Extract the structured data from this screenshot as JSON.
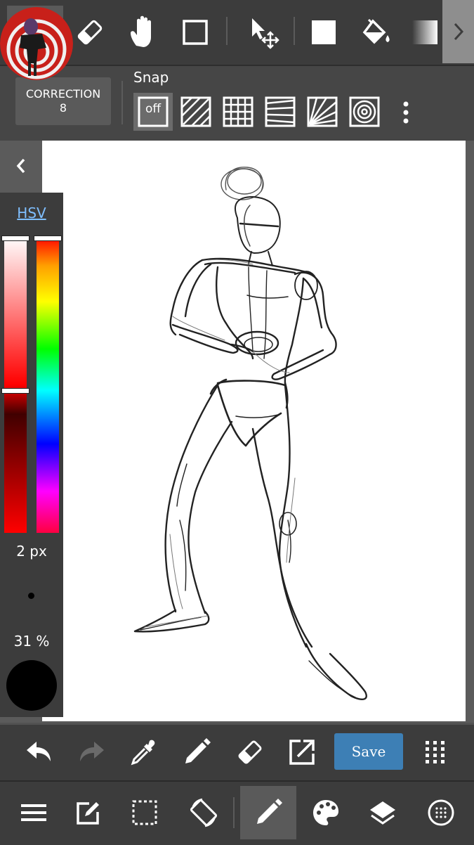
{
  "toolbar": {
    "tools": [
      "brush-icon",
      "eraser-icon",
      "hand-icon",
      "rectangle-select-icon",
      "move-icon",
      "fill-square-icon",
      "bucket-icon",
      "gradient-icon"
    ],
    "more_icon": "chevron-right-icon"
  },
  "snap_panel": {
    "correction_label": "CORRECTION",
    "correction_value": "8",
    "snap_label": "Snap",
    "off_label": "off",
    "selected": "off",
    "modes": [
      "off",
      "parallel",
      "grid",
      "vanishing",
      "radial",
      "concentric"
    ]
  },
  "color_panel": {
    "mode_label": "HSV",
    "brush_size": "2 px",
    "opacity": "31 %",
    "current_color": "#000000",
    "saturation_value": 0.52,
    "hue_level": 0.0
  },
  "action_bar": {
    "save_label": "Save",
    "icons": [
      "undo-icon",
      "redo-icon",
      "eyedropper-icon",
      "pen-icon",
      "eraser-icon",
      "export-icon",
      "grid-dots-icon"
    ]
  },
  "nav_bar": {
    "icons": [
      "menu-icon",
      "edit-icon",
      "selection-icon",
      "rotate-icon",
      "pen-icon",
      "palette-icon",
      "layers-icon",
      "dotted-circle-icon"
    ],
    "selected": "pen-icon"
  },
  "colors": {
    "accent": "#3d7fb5",
    "toolbar_bg": "#3c3c3c",
    "hsv_link": "#7fbfff"
  }
}
